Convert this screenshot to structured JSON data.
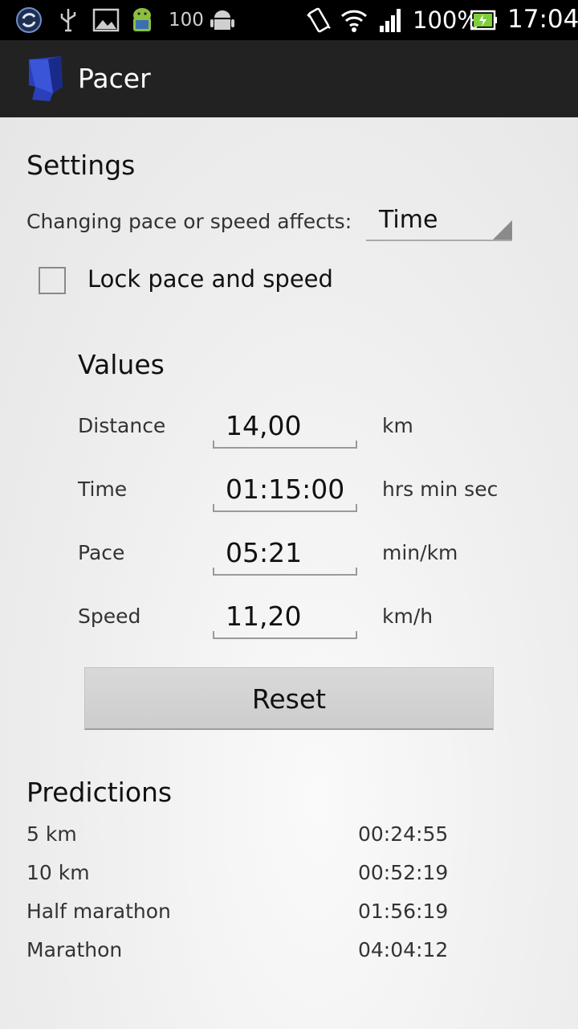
{
  "status_bar": {
    "notification_count": "100",
    "battery": "100%",
    "time": "17:04",
    "icons": [
      "sync-icon",
      "usb-icon",
      "image-icon",
      "android-mascot-icon",
      "android-icon",
      "vibrate-icon",
      "wifi-icon",
      "signal-icon",
      "battery-icon"
    ]
  },
  "action_bar": {
    "title": "Pacer",
    "logo_icon": "pacer-logo-icon"
  },
  "settings": {
    "heading": "Settings",
    "affects_label": "Changing pace or speed affects:",
    "affects_value": "Time",
    "lock_label": "Lock pace and speed",
    "lock_checked": false
  },
  "values": {
    "heading": "Values",
    "rows": [
      {
        "label": "Distance",
        "value": "14,00",
        "unit": "km"
      },
      {
        "label": "Time",
        "value": "01:15:00",
        "unit": "hrs min sec"
      },
      {
        "label": "Pace",
        "value": "05:21",
        "unit": "min/km"
      },
      {
        "label": "Speed",
        "value": "11,20",
        "unit": "km/h"
      }
    ]
  },
  "reset_label": "Reset",
  "predictions": {
    "heading": "Predictions",
    "rows": [
      {
        "label": "5 km",
        "value": "00:24:55"
      },
      {
        "label": "10 km",
        "value": "00:52:19"
      },
      {
        "label": "Half marathon",
        "value": "01:56:19"
      },
      {
        "label": "Marathon",
        "value": "04:04:12"
      }
    ]
  },
  "colors": {
    "action_bar": "#222222",
    "logo": "#2a3fb8",
    "background": "#ececec"
  }
}
